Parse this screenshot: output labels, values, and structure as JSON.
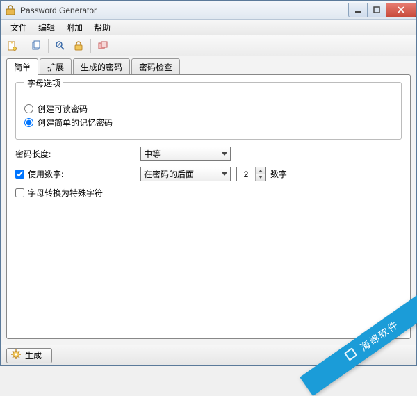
{
  "window": {
    "title": "Password Generator"
  },
  "menu": {
    "file": "文件",
    "edit": "编辑",
    "extra": "附加",
    "help": "帮助"
  },
  "toolbar_icons": {
    "new": "new-doc-icon",
    "copy": "copy-icon",
    "search": "search-icon",
    "lock": "lock-icon",
    "clone": "duplicate-icon"
  },
  "tabs": {
    "simple": "简单",
    "extended": "扩展",
    "generated": "生成的密码",
    "check": "密码检查"
  },
  "panel": {
    "letter_options_legend": "字母选项",
    "radio_readable": "创建可读密码",
    "radio_memorable": "创建简单的记忆密码",
    "length_label": "密码长度:",
    "length_value": "中等",
    "use_digits_label": "使用数字:",
    "digits_position": "在密码的后面",
    "digits_count": "2",
    "digits_suffix": "数字",
    "letters_to_special": "字母转换为特殊字符"
  },
  "footer": {
    "generate": "生成"
  },
  "banner": {
    "text": "海绵软件"
  }
}
